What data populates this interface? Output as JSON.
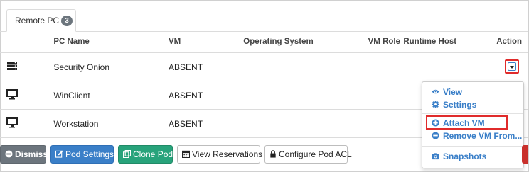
{
  "tabs": [
    {
      "label": "Remote PC",
      "count": "3"
    }
  ],
  "table": {
    "columns": [
      "PC Name",
      "VM",
      "Operating System",
      "VM Role",
      "Runtime Host",
      "Action"
    ],
    "rows": [
      {
        "icon": "server-icon",
        "name": "Security Onion",
        "vm": "ABSENT",
        "os": "",
        "role": "",
        "host": ""
      },
      {
        "icon": "monitor-icon",
        "name": "WinClient",
        "vm": "ABSENT",
        "os": "",
        "role": "",
        "host": ""
      },
      {
        "icon": "monitor-icon",
        "name": "Workstation",
        "vm": "ABSENT",
        "os": "",
        "role": "",
        "host": ""
      }
    ]
  },
  "action_menu": {
    "items": [
      {
        "icon": "eye-icon",
        "label": "View"
      },
      {
        "icon": "gear-icon",
        "label": "Settings"
      },
      {
        "icon": "plus-circle-icon",
        "label": "Attach VM",
        "highlighted": true
      },
      {
        "icon": "minus-circle-icon",
        "label": "Remove VM From..."
      },
      {
        "icon": "camera-icon",
        "label": "Snapshots"
      }
    ]
  },
  "toolbar": {
    "dismiss": "Dismiss",
    "pod_settings": "Pod Settings",
    "clone_pod": "Clone Pod",
    "view_reservations": "View Reservations",
    "configure_acl": "Configure Pod ACL"
  },
  "colors": {
    "accent": "#3a7fc8",
    "highlight": "#e02b2b",
    "success": "#28a37b",
    "secondary": "#6c757d",
    "danger": "#c9302c"
  }
}
